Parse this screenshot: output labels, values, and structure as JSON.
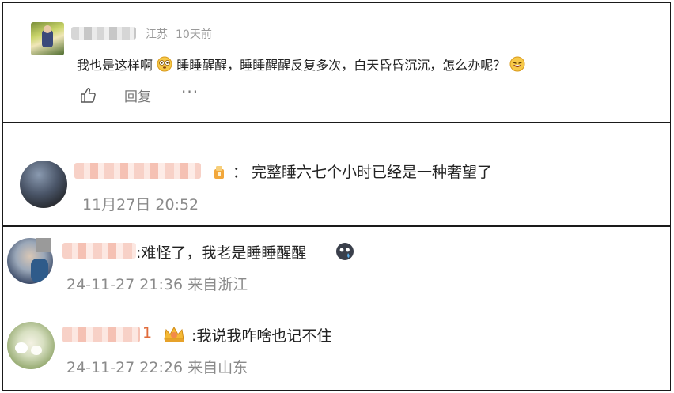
{
  "comment1": {
    "location": "江苏",
    "time_ago": "10天前",
    "text_a": "我也是这样啊",
    "text_b": "睡睡醒醒，睡睡醒醒反复多次，白天昏昏沉沉，怎么办呢？",
    "reply_label": "回复",
    "more_label": "···"
  },
  "comment2": {
    "separator": "：",
    "text": "完整睡六七个小时已经是一种奢望了",
    "timestamp": "11月27日 20:52"
  },
  "comment3": {
    "text_a": ":难怪了，我老是睡睡醒醒",
    "timestamp": "24-11-27 21:36 来自浙江"
  },
  "comment4": {
    "name_tail": "1",
    "text": ":我说我咋啥也记不住",
    "timestamp": "24-11-27 22:26 来自山东"
  }
}
